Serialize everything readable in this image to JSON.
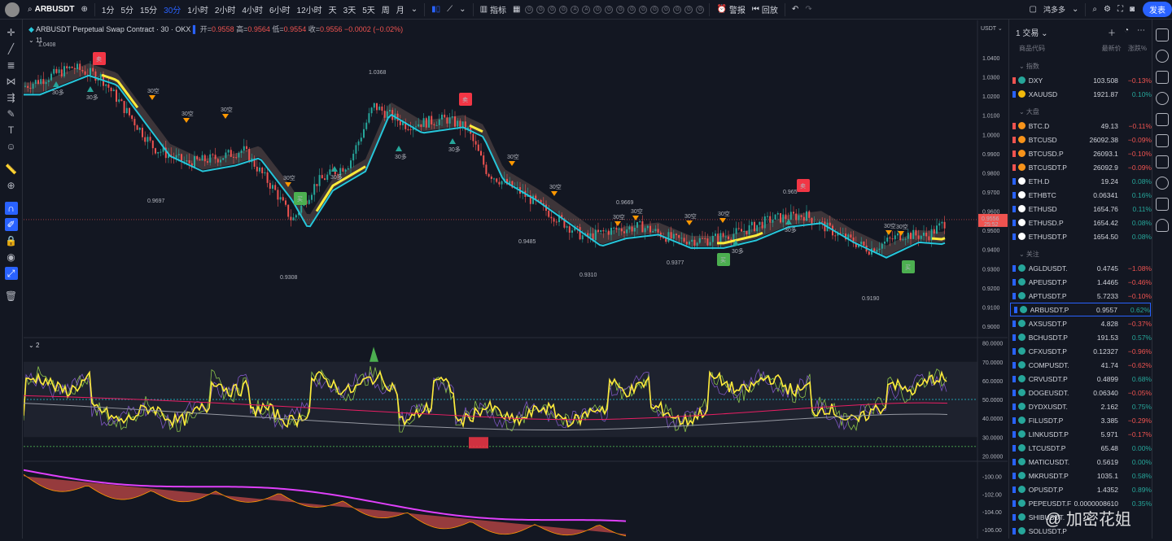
{
  "topbar": {
    "symbol": "ARBUSDT",
    "intervals": [
      "1分",
      "5分",
      "15分",
      "30分",
      "1小时",
      "2小时",
      "4小时",
      "6小时",
      "12小时",
      "天",
      "3天",
      "5天",
      "周",
      "月"
    ],
    "active_interval": "30分",
    "indicators_label": "指标",
    "alert_label": "警报",
    "replay_label": "回放",
    "user_label": "鸿多多",
    "publish_label": "发表",
    "circle_letters": [
      "G",
      "G",
      "G",
      "G",
      "A",
      "A",
      "G",
      "G",
      "G",
      "G",
      "G",
      "G",
      "G",
      "G",
      "G",
      "G"
    ]
  },
  "legend": {
    "title": "ARBUSDT Perpetual Swap Contract · 30 · OKX",
    "open_label": "开=",
    "open": "0.9558",
    "high_label": "高=",
    "high": "0.9564",
    "low_label": "低=",
    "low": "0.9554",
    "close_label": "收=",
    "close": "0.9556",
    "change": "−0.0002 (−0.02%)",
    "sub_count": "11",
    "pane2_label": "2"
  },
  "price_axis": {
    "unit": "USDT",
    "ticks": [
      "1.0400",
      "1.0300",
      "1.0200",
      "1.0100",
      "1.0000",
      "0.9900",
      "0.9800",
      "0.9700",
      "0.9600",
      "0.9500",
      "0.9400",
      "0.9300",
      "0.9200",
      "0.9100",
      "0.9000"
    ],
    "current_price": "0.9556",
    "current_time": "25:52"
  },
  "osc_axis": {
    "ticks": [
      "80.0000",
      "70.0000",
      "60.0000",
      "50.0000",
      "40.0000",
      "30.0000",
      "20.0000"
    ]
  },
  "pane3_axis": {
    "ticks": [
      "-100.00",
      "-102.00",
      "-104.00",
      "-106.00"
    ]
  },
  "annotations": {
    "price_labels": [
      "1.0408",
      "0.9697",
      "1.0368",
      "0.9308",
      "0.9485",
      "0.9310",
      "0.9669",
      "0.9377",
      "0.965",
      "0.9190"
    ],
    "buy_text": "买",
    "sell_text": "卖",
    "short_tag": "30空",
    "long_tag": "30多"
  },
  "watchlist": {
    "title": "1 交易",
    "col_symbol": "商品代码",
    "col_last": "最新价",
    "col_change": "涨跌%",
    "sections": [
      {
        "name": "指数",
        "items": [
          {
            "sym": "DXY",
            "last": "103.508",
            "chg": "−0.13%",
            "dir": "neg",
            "coin": "#26a69a"
          },
          {
            "sym": "XAUUSD",
            "last": "1921.87",
            "chg": "0.10%",
            "dir": "pos",
            "coin": "#f0b90b"
          }
        ]
      },
      {
        "name": "大盘",
        "items": [
          {
            "sym": "BTC.D",
            "last": "49.13",
            "chg": "−0.11%",
            "dir": "neg",
            "coin": "#f7931a"
          },
          {
            "sym": "BTCUSD",
            "last": "26092.38",
            "chg": "−0.09%",
            "dir": "neg",
            "coin": "#f7931a"
          },
          {
            "sym": "BTCUSD.P",
            "last": "26093.1",
            "chg": "−0.10%",
            "dir": "neg",
            "coin": "#f7931a"
          },
          {
            "sym": "BTCUSDT.P",
            "last": "26092.9",
            "chg": "−0.09%",
            "dir": "neg",
            "coin": "#f7931a"
          },
          {
            "sym": "ETH.D",
            "last": "19.24",
            "chg": "0.08%",
            "dir": "pos",
            "coin": "#ffffff"
          },
          {
            "sym": "ETHBTC",
            "last": "0.06341",
            "chg": "0.16%",
            "dir": "pos",
            "coin": "#ffffff"
          },
          {
            "sym": "ETHUSD",
            "last": "1654.76",
            "chg": "0.11%",
            "dir": "pos",
            "coin": "#ffffff"
          },
          {
            "sym": "ETHUSD.P",
            "last": "1654.42",
            "chg": "0.08%",
            "dir": "pos",
            "coin": "#ffffff"
          },
          {
            "sym": "ETHUSDT.P",
            "last": "1654.50",
            "chg": "0.08%",
            "dir": "pos",
            "coin": "#ffffff"
          }
        ]
      },
      {
        "name": "关注",
        "items": [
          {
            "sym": "AGLDUSDT.",
            "last": "0.4745",
            "chg": "−1.08%",
            "dir": "neg",
            "coin": "#26a69a"
          },
          {
            "sym": "APEUSDT.P",
            "last": "1.4465",
            "chg": "−0.46%",
            "dir": "neg",
            "coin": "#26a69a"
          },
          {
            "sym": "APTUSDT.P",
            "last": "5.7233",
            "chg": "−0.10%",
            "dir": "neg",
            "coin": "#26a69a"
          },
          {
            "sym": "ARBUSDT.P",
            "last": "0.9557",
            "chg": "0.62%",
            "dir": "pos",
            "coin": "#26a69a",
            "selected": true
          },
          {
            "sym": "AXSUSDT.P",
            "last": "4.828",
            "chg": "−0.37%",
            "dir": "neg",
            "coin": "#26a69a"
          },
          {
            "sym": "BCHUSDT.P",
            "last": "191.53",
            "chg": "0.57%",
            "dir": "pos",
            "coin": "#26a69a"
          },
          {
            "sym": "CFXUSDT.P",
            "last": "0.12327",
            "chg": "−0.96%",
            "dir": "neg",
            "coin": "#26a69a"
          },
          {
            "sym": "COMPUSDT.",
            "last": "41.74",
            "chg": "−0.62%",
            "dir": "neg",
            "coin": "#26a69a"
          },
          {
            "sym": "CRVUSDT.P",
            "last": "0.4899",
            "chg": "0.68%",
            "dir": "pos",
            "coin": "#26a69a"
          },
          {
            "sym": "DOGEUSDT.",
            "last": "0.06340",
            "chg": "−0.05%",
            "dir": "neg",
            "coin": "#26a69a"
          },
          {
            "sym": "DYDXUSDT.",
            "last": "2.162",
            "chg": "0.75%",
            "dir": "pos",
            "coin": "#26a69a"
          },
          {
            "sym": "FILUSDT.P",
            "last": "3.385",
            "chg": "−0.29%",
            "dir": "neg",
            "coin": "#26a69a"
          },
          {
            "sym": "LINKUSDT.P",
            "last": "5.971",
            "chg": "−0.17%",
            "dir": "neg",
            "coin": "#26a69a"
          },
          {
            "sym": "LTCUSDT.P",
            "last": "65.48",
            "chg": "0.00%",
            "dir": "pos",
            "coin": "#26a69a"
          },
          {
            "sym": "MATICUSDT.",
            "last": "0.5619",
            "chg": "0.00%",
            "dir": "pos",
            "coin": "#26a69a"
          },
          {
            "sym": "MKRUSDT.P",
            "last": "1035.1",
            "chg": "0.58%",
            "dir": "pos",
            "coin": "#26a69a"
          },
          {
            "sym": "OPUSDT.P",
            "last": "1.4352",
            "chg": "0.89%",
            "dir": "pos",
            "coin": "#26a69a"
          },
          {
            "sym": "PEPEUSDT.F",
            "last": "0.0000008610",
            "chg": "0.35%",
            "dir": "pos",
            "coin": "#26a69a"
          },
          {
            "sym": "SHIBUSDT.",
            "last": "",
            "chg": "",
            "dir": "pos",
            "coin": "#26a69a"
          },
          {
            "sym": "SOLUSDT.P",
            "last": "",
            "chg": "",
            "dir": "pos",
            "coin": "#26a69a"
          }
        ]
      }
    ]
  },
  "watermark": "@ 加密花姐",
  "colors": {
    "up": "#26a69a",
    "down": "#ef5350",
    "accent": "#2962ff",
    "ribbon": "#26c6da",
    "highlight": "#ffeb3b"
  }
}
